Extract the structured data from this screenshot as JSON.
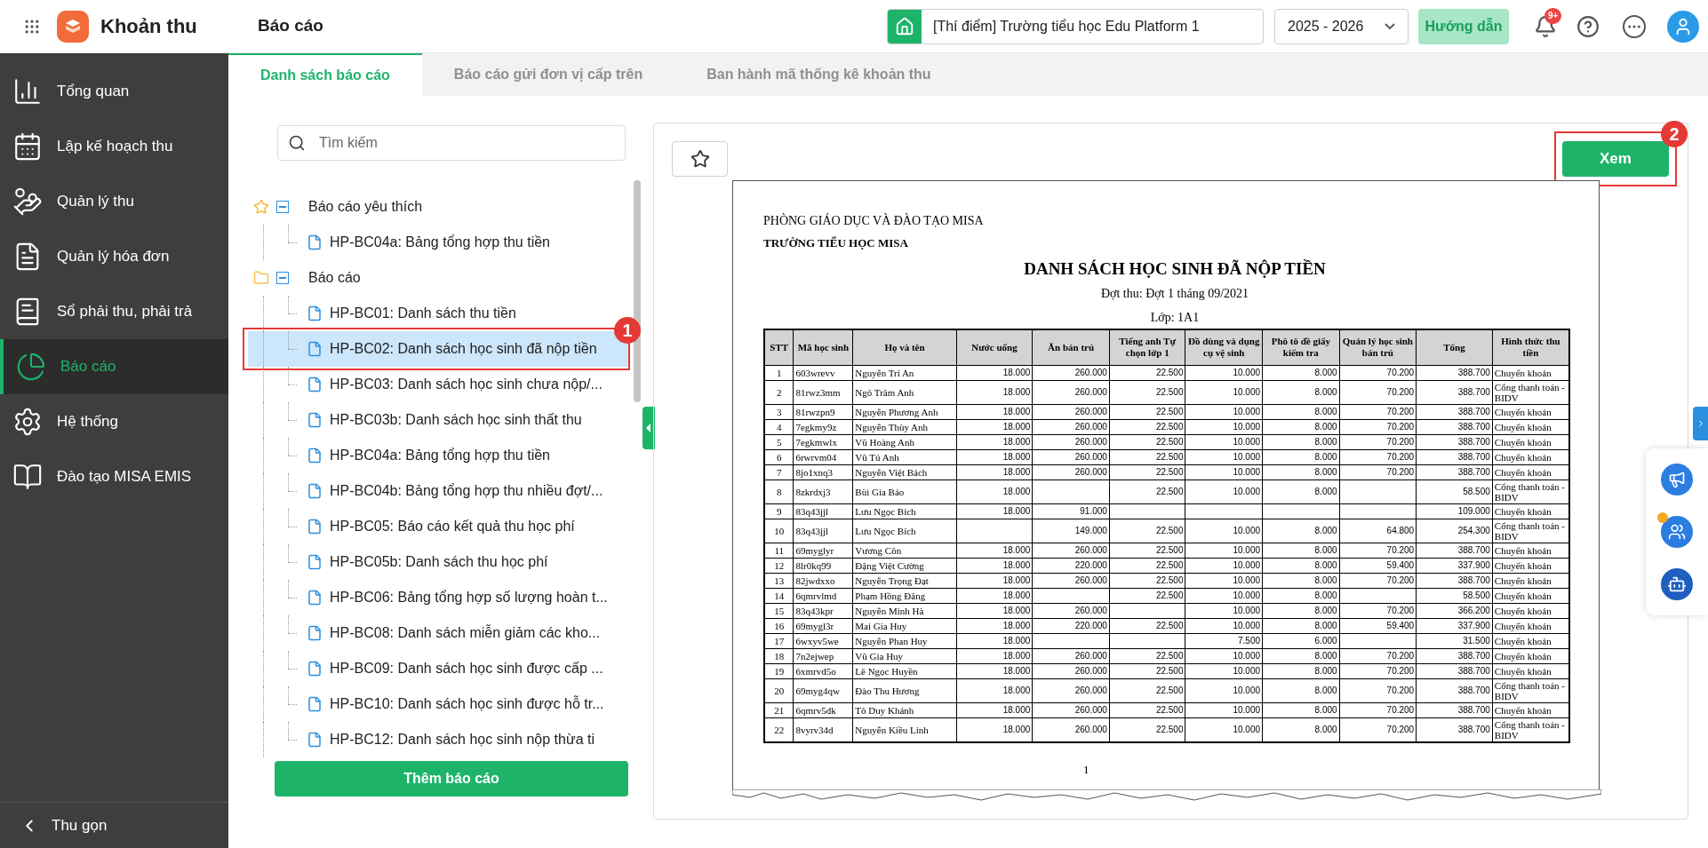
{
  "app": {
    "name": "Khoản thu"
  },
  "header": {
    "page_title": "Báo cáo",
    "school": "[Thí điểm] Trường tiểu học Edu Platform 1",
    "year": "2025 - 2026",
    "guide_button": "Hướng dẫn",
    "notification_badge": "9+"
  },
  "sidebar": {
    "items": [
      {
        "label": "Tổng quan",
        "selected": false
      },
      {
        "label": "Lập kế hoạch thu",
        "selected": false
      },
      {
        "label": "Quản lý thu",
        "selected": false
      },
      {
        "label": "Quản lý hóa đơn",
        "selected": false
      },
      {
        "label": "Sổ phải thu, phải trả",
        "selected": false
      },
      {
        "label": "Báo cáo",
        "selected": true
      },
      {
        "label": "Hệ thống",
        "selected": false
      },
      {
        "label": "Đào tạo MISA EMIS",
        "selected": false
      }
    ],
    "collapse": "Thu gọn"
  },
  "tabs": [
    {
      "label": "Danh sách báo cáo",
      "selected": true
    },
    {
      "label": "Báo cáo gửi đơn vị cấp trên",
      "selected": false
    },
    {
      "label": "Ban hành mã thống kê khoản thu",
      "selected": false
    }
  ],
  "search": {
    "placeholder": "Tìm kiếm"
  },
  "tree": [
    {
      "label": "Báo cáo yêu thích",
      "kind": "favorites",
      "expanded": true,
      "children": [
        {
          "label": "HP-BC04a: Bảng tổng hợp thu tiền",
          "selected": false
        }
      ]
    },
    {
      "label": "Báo cáo",
      "kind": "folder",
      "expanded": true,
      "children": [
        {
          "label": "HP-BC01: Danh sách thu tiền",
          "selected": false
        },
        {
          "label": "HP-BC02: Danh sách học sinh đã nộp tiền",
          "selected": true
        },
        {
          "label": "HP-BC03: Danh sách học sinh chưa nộp/...",
          "selected": false
        },
        {
          "label": "HP-BC03b: Danh sách học sinh thất thu",
          "selected": false
        },
        {
          "label": "HP-BC04a: Bảng tổng hợp thu tiền",
          "selected": false
        },
        {
          "label": "HP-BC04b: Bảng tổng hợp thu nhiều đợt/...",
          "selected": false
        },
        {
          "label": "HP-BC05: Báo cáo kết quả thu học phí",
          "selected": false
        },
        {
          "label": "HP-BC05b: Danh sách thu học phí",
          "selected": false
        },
        {
          "label": "HP-BC06: Bảng tổng hợp số lượng hoàn t...",
          "selected": false
        },
        {
          "label": "HP-BC08: Danh sách miễn giảm các kho...",
          "selected": false
        },
        {
          "label": "HP-BC09: Danh sách học sinh được cấp ...",
          "selected": false
        },
        {
          "label": "HP-BC10: Danh sách học sinh được hỗ tr...",
          "selected": false
        },
        {
          "label": "HP-BC12: Danh sách học sinh nộp thừa ti",
          "selected": false
        }
      ]
    }
  ],
  "add_button": "Thêm báo cáo",
  "view_button": "Xem",
  "callouts": [
    "1",
    "2"
  ],
  "report": {
    "org": "PHÒNG GIÁO DỤC VÀ ĐÀO TẠO  MISA",
    "school": "TRƯỜNG TIỂU HỌC  MISA",
    "title": "DANH SÁCH HỌC SINH ĐÃ NỘP TIỀN",
    "period": "Đợt thu: Đợt 1 tháng 09/2021",
    "class": "Lớp: 1A1",
    "columns": [
      "STT",
      "Mã học sinh",
      "Họ và tên",
      "Nước uống",
      "Ăn bán trú",
      "Tiếng anh Tự chọn lớp 1",
      "Đồ dùng và dụng cụ vệ sinh",
      "Phô tô đề giấy kiểm tra",
      "Quản lý học sinh bán trú",
      "Tổng",
      "Hình thức thu tiền"
    ],
    "rows": [
      [
        "1",
        "603wrevv",
        "Nguyễn Trí An",
        "18.000",
        "260.000",
        "22.500",
        "10.000",
        "8.000",
        "70.200",
        "388.700",
        "Chuyển khoản"
      ],
      [
        "2",
        "81rwz3mm",
        "Ngô Trâm Anh",
        "18.000",
        "260.000",
        "22.500",
        "10.000",
        "8.000",
        "70.200",
        "388.700",
        "Cổng thanh toán - BIDV"
      ],
      [
        "3",
        "81rwzpn9",
        "Nguyễn Phương Anh",
        "18.000",
        "260.000",
        "22.500",
        "10.000",
        "8.000",
        "70.200",
        "388.700",
        "Chuyển khoản"
      ],
      [
        "4",
        "7egkmy9z",
        "Nguyễn Thùy Anh",
        "18.000",
        "260.000",
        "22.500",
        "10.000",
        "8.000",
        "70.200",
        "388.700",
        "Chuyển khoản"
      ],
      [
        "5",
        "7egkmwlx",
        "Vũ Hoàng Anh",
        "18.000",
        "260.000",
        "22.500",
        "10.000",
        "8.000",
        "70.200",
        "388.700",
        "Chuyển khoản"
      ],
      [
        "6",
        "6rwrvm04",
        "Vũ Tú Anh",
        "18.000",
        "260.000",
        "22.500",
        "10.000",
        "8.000",
        "70.200",
        "388.700",
        "Chuyển khoản"
      ],
      [
        "7",
        "8jo1xnq3",
        "Nguyễn Việt Bách",
        "18.000",
        "260.000",
        "22.500",
        "10.000",
        "8.000",
        "70.200",
        "388.700",
        "Chuyển khoản"
      ],
      [
        "8",
        "8zkrdxj3",
        "Bùi Gia Báo",
        "18.000",
        null,
        "22.500",
        "10.000",
        "8.000",
        null,
        "58.500",
        "Cổng thanh toán - BIDV"
      ],
      [
        "9",
        "83q43jjl",
        "Lưu Ngọc Bích",
        "18.000",
        "91.000",
        null,
        null,
        null,
        null,
        "109.000",
        "Chuyển khoản"
      ],
      [
        "10",
        "83q43jjl",
        "Lưu Ngọc Bích",
        null,
        "149.000",
        "22.500",
        "10.000",
        "8.000",
        "64.800",
        "254.300",
        "Cổng thanh toán - BIDV"
      ],
      [
        "11",
        "69myglyr",
        "Vương Côn",
        "18.000",
        "260.000",
        "22.500",
        "10.000",
        "8.000",
        "70.200",
        "388.700",
        "Chuyển khoản"
      ],
      [
        "12",
        "8lr0kq99",
        "Đặng Việt Cường",
        "18.000",
        "220.000",
        "22.500",
        "10.000",
        "8.000",
        "59.400",
        "337.900",
        "Chuyển khoản"
      ],
      [
        "13",
        "82jwdxxo",
        "Nguyễn Trọng Đạt",
        "18.000",
        "260.000",
        "22.500",
        "10.000",
        "8.000",
        "70.200",
        "388.700",
        "Chuyển khoản"
      ],
      [
        "14",
        "6qmrvlmd",
        "Phạm Hồng Đăng",
        "18.000",
        null,
        "22.500",
        "10.000",
        "8.000",
        null,
        "58.500",
        "Chuyển khoản"
      ],
      [
        "15",
        "83q43kpr",
        "Nguyễn Minh Hà",
        "18.000",
        "260.000",
        null,
        "10.000",
        "8.000",
        "70.200",
        "366.200",
        "Chuyển khoản"
      ],
      [
        "16",
        "69mygl3r",
        "Mai Gia Huy",
        "18.000",
        "220.000",
        "22.500",
        "10.000",
        "8.000",
        "59.400",
        "337.900",
        "Chuyển khoản"
      ],
      [
        "17",
        "6wxyv5we",
        "Nguyễn Phan Huy",
        "18.000",
        null,
        null,
        "7.500",
        "6.000",
        null,
        "31.500",
        "Chuyển khoản"
      ],
      [
        "18",
        "7n2ejwep",
        "Vũ Gia Huy",
        "18.000",
        "260.000",
        "22.500",
        "10.000",
        "8.000",
        "70.200",
        "388.700",
        "Chuyển khoản"
      ],
      [
        "19",
        "6xmrvd5o",
        "Lê Ngọc Huyền",
        "18.000",
        "260.000",
        "22.500",
        "10.000",
        "8.000",
        "70.200",
        "388.700",
        "Chuyển khoản"
      ],
      [
        "20",
        "69myg4qw",
        "Đào Thu Hương",
        "18.000",
        "260.000",
        "22.500",
        "10.000",
        "8.000",
        "70.200",
        "388.700",
        "Cổng thanh toán - BIDV"
      ],
      [
        "21",
        "6qmrv5dk",
        "Tô Duy Khánh",
        "18.000",
        "260.000",
        "22.500",
        "10.000",
        "8.000",
        "70.200",
        "388.700",
        "Chuyển khoản"
      ],
      [
        "22",
        "8vyrv34d",
        "Nguyễn Kiều Linh",
        "18.000",
        "260.000",
        "22.500",
        "10.000",
        "8.000",
        "70.200",
        "388.700",
        "Cổng thanh toán - BIDV"
      ]
    ],
    "page_number": "1"
  }
}
